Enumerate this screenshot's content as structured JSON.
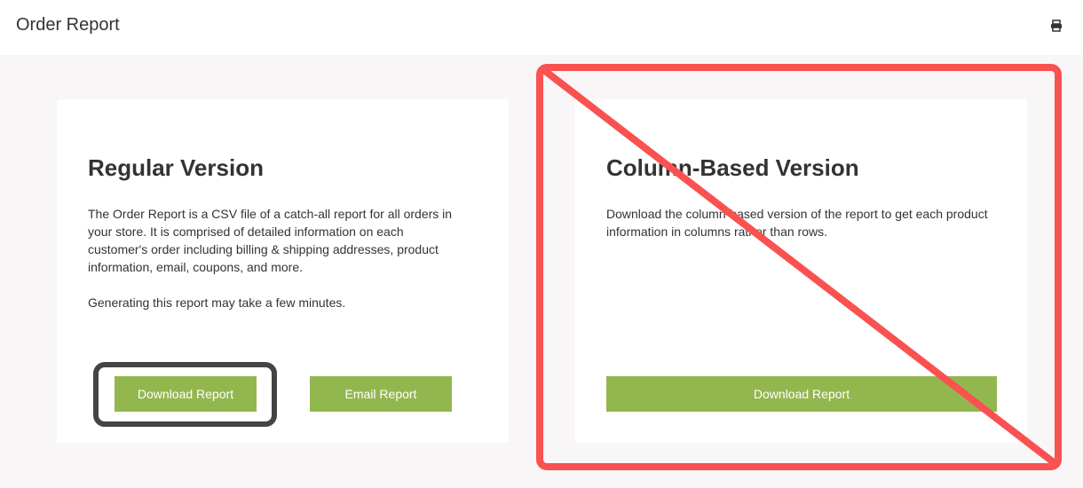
{
  "header": {
    "title": "Order Report",
    "print_icon": "printer-icon"
  },
  "cards": {
    "regular": {
      "title": "Regular Version",
      "description": "The Order Report is a CSV file of a catch-all report for all orders in your store. It is comprised of detailed information on each customer's order including billing & shipping addresses, product information, email, coupons, and more.",
      "note": "Generating this report may take a few minutes.",
      "download_label": "Download Report",
      "email_label": "Email Report"
    },
    "column": {
      "title": "Column-Based Version",
      "description": "Download the column-based version of the report to get each product information in columns rather than rows.",
      "download_label": "Download Report"
    }
  },
  "colors": {
    "button": "#93b74f",
    "background": "#f8f6f7",
    "focus_ring": "#444444",
    "strike_mark": "#fa5151"
  }
}
